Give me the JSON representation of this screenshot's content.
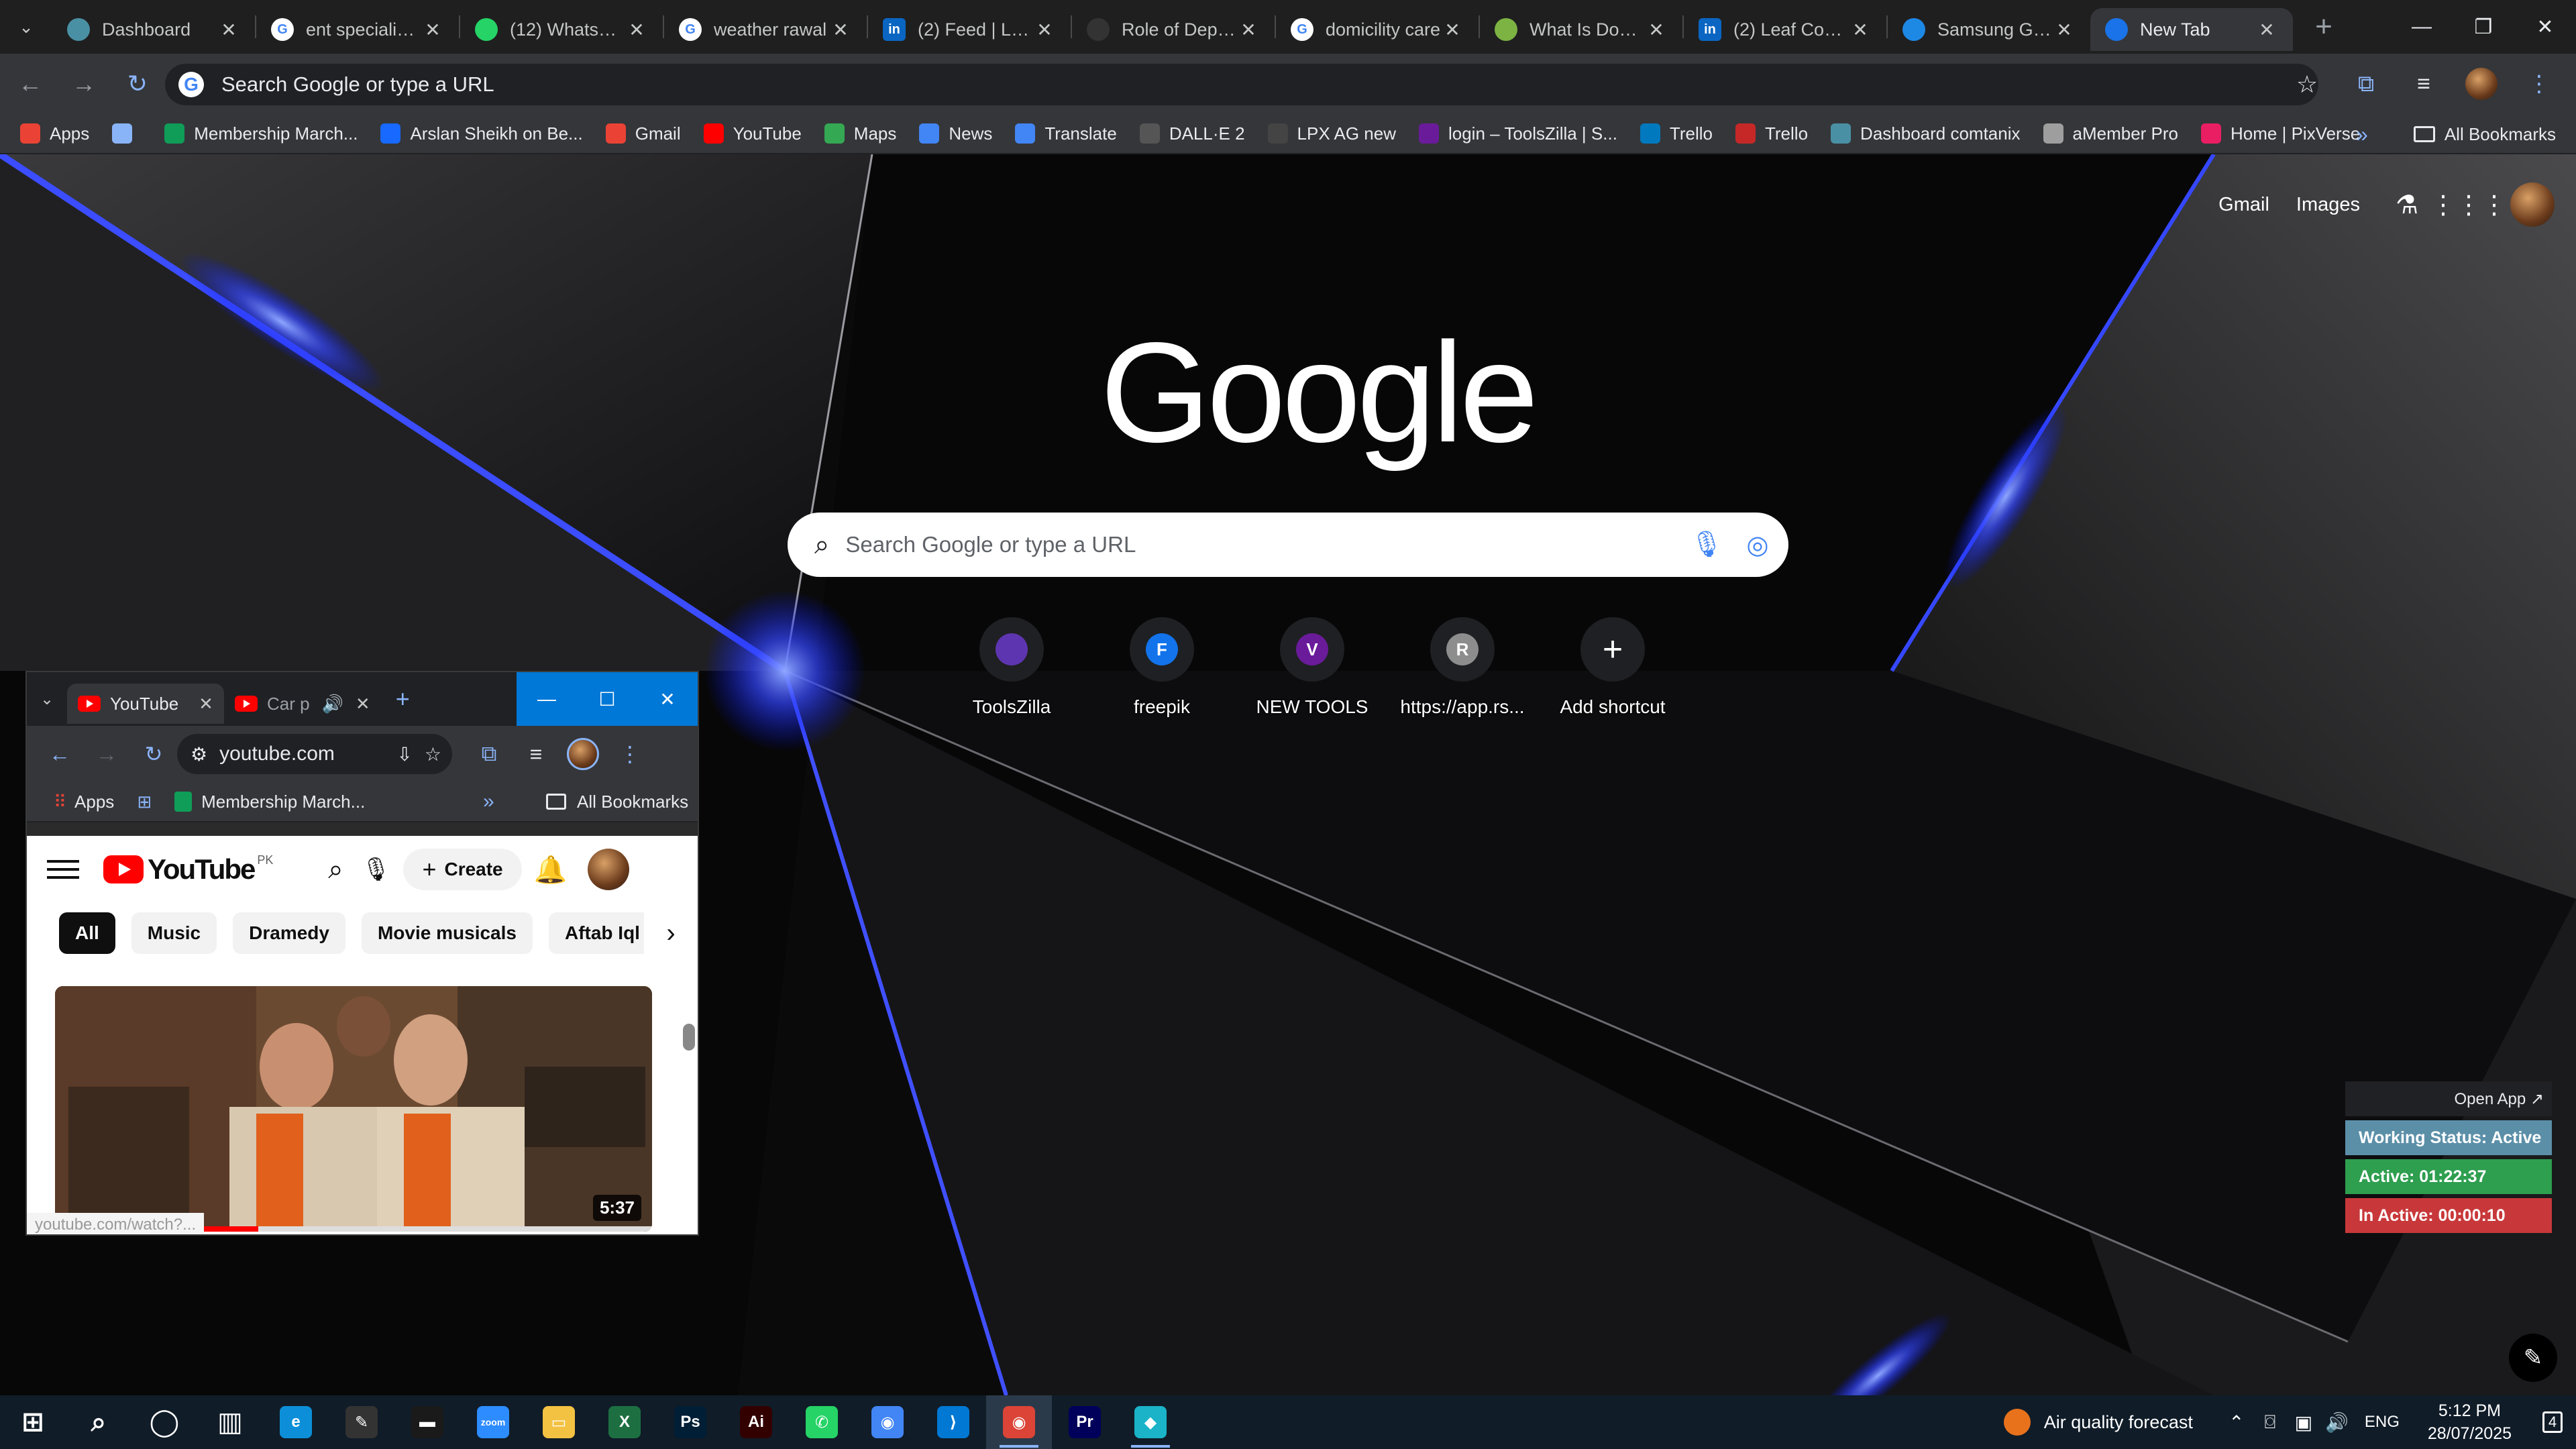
{
  "browser": {
    "tabs": [
      {
        "title": "Dashboard",
        "icon": "dashboard-icon",
        "color": "#4a90a4",
        "active": false
      },
      {
        "title": "ent specialist b",
        "icon": "google-icon",
        "color": "#ffffff",
        "active": false
      },
      {
        "title": "(12) WhatsApp",
        "icon": "whatsapp-icon",
        "color": "#25d366",
        "active": false
      },
      {
        "title": "weather rawal",
        "icon": "google-icon",
        "color": "#ffffff",
        "active": false
      },
      {
        "title": "(2) Feed | Linke",
        "icon": "linkedin-icon",
        "color": "#0a66c2",
        "active": false
      },
      {
        "title": "Role of Deputy",
        "icon": "chatgpt-icon",
        "color": "#333333",
        "active": false
      },
      {
        "title": "domicility care",
        "icon": "google-icon",
        "color": "#ffffff",
        "active": false
      },
      {
        "title": "What Is Domic",
        "icon": "leaf-icon",
        "color": "#7cb342",
        "active": false
      },
      {
        "title": "(2) Leaf Compl",
        "icon": "linkedin-icon",
        "color": "#0a66c2",
        "active": false
      },
      {
        "title": "Samsung Galax",
        "icon": "samsung-icon",
        "color": "#1e88e5",
        "active": false
      },
      {
        "title": "New Tab",
        "icon": "chrome-icon",
        "color": "#1a73e8",
        "active": true
      }
    ],
    "omnibox_placeholder": "Search Google or type a URL",
    "bookmarks": [
      {
        "label": "Apps",
        "icon": "apps-grid-icon",
        "color": "#ea4335"
      },
      {
        "label": "",
        "icon": "tab-groups-icon",
        "color": "#8ab4f8"
      },
      {
        "label": "Membership March...",
        "icon": "sheets-icon",
        "color": "#0f9d58"
      },
      {
        "label": "Arslan Sheikh on Be...",
        "icon": "behance-icon",
        "color": "#1769ff"
      },
      {
        "label": "Gmail",
        "icon": "gmail-icon",
        "color": "#ea4335"
      },
      {
        "label": "YouTube",
        "icon": "youtube-icon",
        "color": "#ff0000"
      },
      {
        "label": "Maps",
        "icon": "maps-icon",
        "color": "#34a853"
      },
      {
        "label": "News",
        "icon": "news-icon",
        "color": "#4285f4"
      },
      {
        "label": "Translate",
        "icon": "translate-icon",
        "color": "#4285f4"
      },
      {
        "label": "DALL·E 2",
        "icon": "openai-icon",
        "color": "#555555"
      },
      {
        "label": "LPX AG new",
        "icon": "lpx-icon",
        "color": "#444444"
      },
      {
        "label": "login – ToolsZilla | S...",
        "icon": "toolszilla-icon",
        "color": "#6a1b9a"
      },
      {
        "label": "Trello",
        "icon": "trello-icon",
        "color": "#0079bf"
      },
      {
        "label": "Trello",
        "icon": "trello-board-icon",
        "color": "#c62828"
      },
      {
        "label": "Dashboard comtanix",
        "icon": "dashboard-icon",
        "color": "#4a90a4"
      },
      {
        "label": "aMember Pro",
        "icon": "amember-icon",
        "color": "#9e9e9e"
      },
      {
        "label": "Home | PixVerse",
        "icon": "pixverse-icon",
        "color": "#e91e63"
      }
    ],
    "all_bookmarks": "All Bookmarks"
  },
  "ntp": {
    "gmail": "Gmail",
    "images": "Images",
    "logo": "Google",
    "search_placeholder": "Search Google or type a URL",
    "shortcuts": [
      {
        "label": "ToolsZilla",
        "letter": "",
        "color": "#5e35b1"
      },
      {
        "label": "freepik",
        "letter": "F",
        "color": "#1273eb"
      },
      {
        "label": "NEW TOOLS",
        "letter": "V",
        "color": "#6a1b9a"
      },
      {
        "label": "https://app.rs...",
        "letter": "R",
        "color": "#8d8d8d"
      },
      {
        "label": "Add shortcut",
        "letter": "+",
        "color": "#1f2023"
      }
    ]
  },
  "tracker": {
    "open_app": "Open App ↗",
    "status": "Working Status: Active",
    "active": "Active: 01:22:37",
    "inactive": "In Active: 00:00:10",
    "colors": {
      "status": "#5b8fa8",
      "active": "#2e9e4f",
      "inactive": "#c8383a"
    }
  },
  "mini_browser": {
    "tabs": [
      {
        "title": "YouTube",
        "active": true
      },
      {
        "title": "Car p",
        "active": false
      }
    ],
    "url": "youtube.com",
    "bookmarks": {
      "apps": "Apps",
      "item": "Membership March...",
      "all": "All Bookmarks"
    },
    "youtube": {
      "country": "PK",
      "create": "Create",
      "chips": [
        "All",
        "Music",
        "Dramedy",
        "Movie musicals",
        "Aftab Iql"
      ],
      "duration": "5:37",
      "progress": 0.34,
      "status_url": "youtube.com/watch?..."
    }
  },
  "taskbar": {
    "apps": [
      {
        "name": "start-button",
        "icon": "windows-icon",
        "color": "#ffffff",
        "label": "⊞",
        "running": false
      },
      {
        "name": "search-button",
        "icon": "search-icon",
        "color": "#ffffff",
        "label": "⌕",
        "running": false
      },
      {
        "name": "cortana-button",
        "icon": "cortana-icon",
        "color": "#ffffff",
        "label": "◯",
        "running": false
      },
      {
        "name": "task-view-button",
        "icon": "task-view-icon",
        "color": "#ffffff",
        "label": "▥",
        "running": false
      },
      {
        "name": "edge-app",
        "icon": "edge-icon",
        "color": "#0c8fd8",
        "label": "e",
        "running": false
      },
      {
        "name": "pen-app",
        "icon": "pen-icon",
        "color": "#333333",
        "label": "✎",
        "running": false
      },
      {
        "name": "terminal-app",
        "icon": "terminal-icon",
        "color": "#1a1a1a",
        "label": "▬",
        "running": false
      },
      {
        "name": "zoom-app",
        "icon": "zoom-icon",
        "color": "#2d8cff",
        "label": "zoom",
        "running": false
      },
      {
        "name": "file-explorer-app",
        "icon": "folder-icon",
        "color": "#f3c242",
        "label": "▭",
        "running": false
      },
      {
        "name": "excel-app",
        "icon": "excel-icon",
        "color": "#1d6f42",
        "label": "X",
        "running": false
      },
      {
        "name": "photoshop-app",
        "icon": "photoshop-icon",
        "color": "#001e36",
        "label": "Ps",
        "running": false
      },
      {
        "name": "illustrator-app",
        "icon": "illustrator-icon",
        "color": "#330000",
        "label": "Ai",
        "running": false
      },
      {
        "name": "whatsapp-desktop-app",
        "icon": "phone-icon",
        "color": "#25d366",
        "label": "✆",
        "running": false
      },
      {
        "name": "chrome-app",
        "icon": "chrome-icon",
        "color": "#4285f4",
        "label": "◉",
        "running": false
      },
      {
        "name": "vscode-app",
        "icon": "vscode-icon",
        "color": "#0078d4",
        "label": "⟩",
        "running": false
      },
      {
        "name": "chrome-running-app",
        "icon": "chrome-icon",
        "color": "#db4437",
        "label": "◉",
        "running": true
      },
      {
        "name": "premiere-app",
        "icon": "premiere-icon",
        "color": "#00005b",
        "label": "Pr",
        "running": false
      },
      {
        "name": "tracker-app",
        "icon": "tracker-icon",
        "color": "#1ab3c8",
        "label": "◆",
        "running": true
      }
    ],
    "weather": "Air quality forecast",
    "lang": "ENG",
    "time": "5:12 PM",
    "date": "28/07/2025",
    "notifications": "4"
  }
}
